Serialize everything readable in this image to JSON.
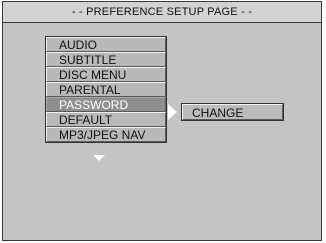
{
  "header": {
    "title": "- - PREFERENCE SETUP PAGE - -"
  },
  "menu": {
    "items": [
      {
        "label": "AUDIO"
      },
      {
        "label": "SUBTITLE"
      },
      {
        "label": "DISC MENU"
      },
      {
        "label": "PARENTAL"
      },
      {
        "label": "PASSWORD"
      },
      {
        "label": "DEFAULT"
      },
      {
        "label": "MP3/JPEG NAV"
      }
    ],
    "selected": "PASSWORD"
  },
  "submenu": {
    "items": [
      {
        "label": "CHANGE"
      }
    ]
  },
  "icons": {
    "submenu_indicator": "triangle-right-icon",
    "scroll_indicator": "triangle-down-icon"
  },
  "colors": {
    "background": "#c4c4c4",
    "selected_item": "#8f8f8f",
    "selected_text": "#ffffff"
  }
}
